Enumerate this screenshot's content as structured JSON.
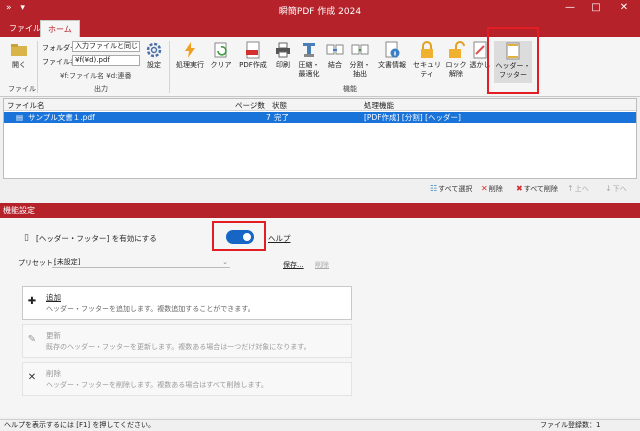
{
  "window": {
    "title": "瞬簡PDF 作成 2024",
    "quick_access": "» ▾",
    "min": "—",
    "max": "□",
    "close": "✕"
  },
  "tabs": [
    {
      "label": "ファイル"
    },
    {
      "label": "ホーム"
    }
  ],
  "ribbon": {
    "open_label": "開く",
    "file_group": "ファイル",
    "folder_label": "フォルダー",
    "folder_value": "入力ファイルと同じ",
    "filename_label": "ファイル名",
    "filename_value": "¥f(¥d).pdf",
    "hint": "¥f:ファイル名 ¥d:連番",
    "output_group": "出力",
    "settings_label": "設定",
    "process_label": "処理実行",
    "clear_label": "クリア",
    "pdf_create": "PDF作成",
    "print": "印刷",
    "compress_line1": "圧縮・",
    "compress_line2": "最適化",
    "merge": "結合",
    "split_line1": "分割・",
    "split_line2": "抽出",
    "docinfo": "文書情報",
    "security": "セキュリティ",
    "unlock_line1": "ロック",
    "unlock_line2": "解除",
    "watermark": "透かし",
    "header_footer_line1": "ヘッダー・",
    "header_footer_line2": "フッター",
    "function_group": "機能"
  },
  "file_list": {
    "headers": {
      "name": "ファイル名",
      "pages": "ページ数",
      "status": "状態",
      "function": "処理機能"
    },
    "rows": [
      {
        "name": "サンプル文書１.pdf",
        "pages": "7",
        "status": "完了",
        "function": "[PDF作成] [分割] [ヘッダー]"
      }
    ]
  },
  "list_tools": {
    "select_all": "すべて選択",
    "delete": "削除",
    "delete_all": "すべて削除",
    "up": "上へ",
    "down": "下へ"
  },
  "section": {
    "title": "機能設定"
  },
  "feature": {
    "enable_label": "[ヘッダー・フッター] を有効にする",
    "enabled": true,
    "help": "ヘルプ",
    "preset_label": "プリセット：",
    "preset_value": "[未設定]",
    "save": "保存...",
    "remove": "削除"
  },
  "actions": [
    {
      "title": "追加",
      "desc": "ヘッダー・フッターを追加します。複数追加することができます。"
    },
    {
      "title": "更新",
      "desc": "既存のヘッダー・フッターを更新します。複数ある場合は一つだけ対象になります。"
    },
    {
      "title": "削除",
      "desc": "ヘッダー・フッターを削除します。複数ある場合はすべて削除します。"
    }
  ],
  "status": {
    "hint": "ヘルプを表示するには [F1] を押してください。",
    "count": "ファイル登録数：1"
  },
  "colors": {
    "brand": "#b5222a",
    "selection": "#1a73d9",
    "toggle": "#1766c5",
    "highlight": "#e21d24"
  }
}
